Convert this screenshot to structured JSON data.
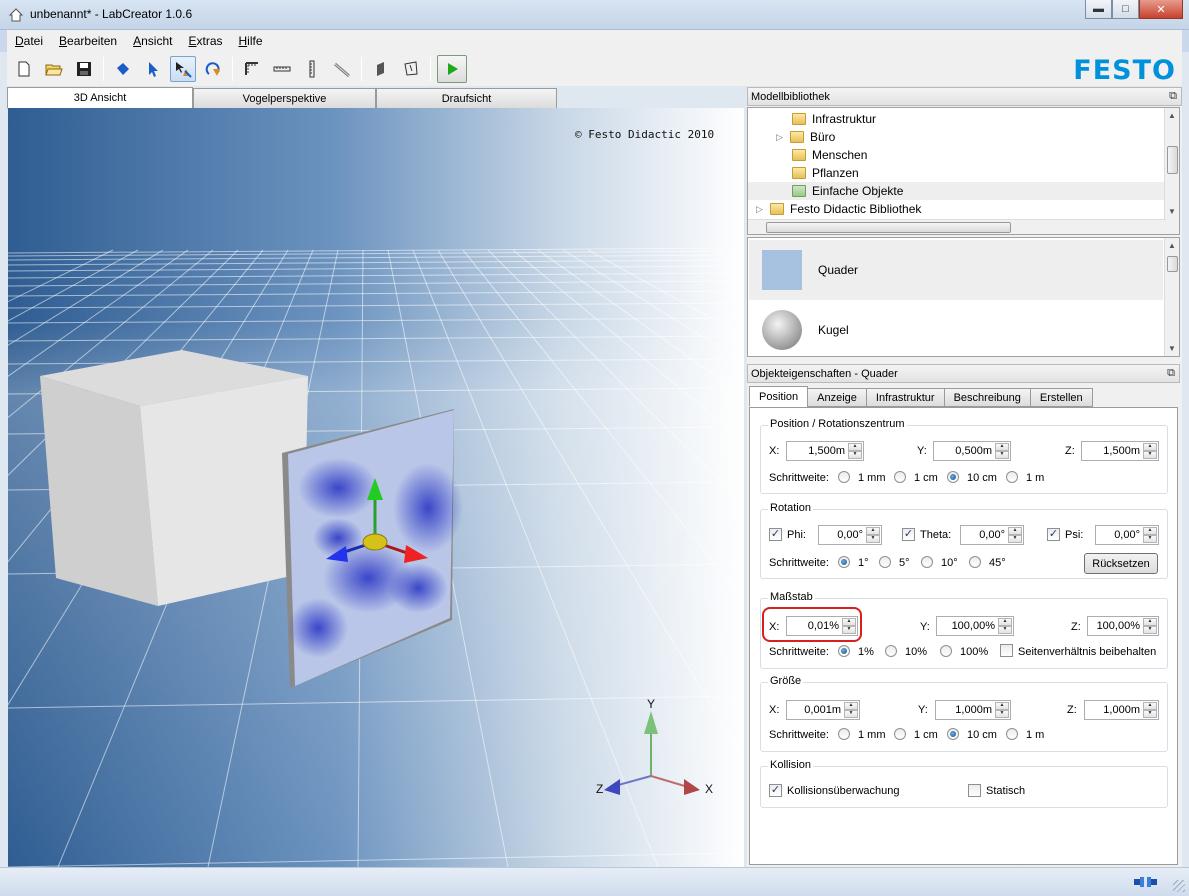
{
  "window": {
    "title": "unbenannt* - LabCreator 1.0.6",
    "minimize": "▬",
    "maximize": "□",
    "close": "✕"
  },
  "menu": [
    {
      "label": "Datei",
      "accel": "D",
      "rest": "atei"
    },
    {
      "label": "Bearbeiten",
      "accel": "B",
      "rest": "earbeiten"
    },
    {
      "label": "Ansicht",
      "accel": "A",
      "rest": "nsicht"
    },
    {
      "label": "Extras",
      "accel": "E",
      "rest": "xtras"
    },
    {
      "label": "Hilfe",
      "accel": "H",
      "rest": "ilfe"
    }
  ],
  "toolbar": {
    "buttons": [
      "new-file-icon",
      "open-folder-icon",
      "save-icon",
      "select-blue-icon",
      "pointer-icon",
      "move-tool-icon",
      "rotate-tool-icon",
      "measure-corner-icon",
      "ruler-horizontal-icon",
      "ruler-vertical-icon",
      "measure-diagonal-icon",
      "wall-icon",
      "polygon-icon",
      "play-icon"
    ],
    "brand": "FESTO",
    "brand_color": "#0091dc"
  },
  "view_tabs": [
    "3D Ansicht",
    "Vogelperspektive",
    "Draufsicht"
  ],
  "viewport": {
    "copyright": "© Festo Didactic 2010",
    "axes": {
      "y": "Y",
      "x": "X",
      "z": "Z"
    }
  },
  "library": {
    "title": "Modellbibliothek",
    "tree": [
      {
        "label": "Infrastruktur",
        "expander": "",
        "kind": "folder"
      },
      {
        "label": "Büro",
        "expander": "▷",
        "kind": "folder"
      },
      {
        "label": "Menschen",
        "expander": "",
        "kind": "folder"
      },
      {
        "label": "Pflanzen",
        "expander": "",
        "kind": "folder"
      },
      {
        "label": "Einfache Objekte",
        "expander": "",
        "kind": "folder-green"
      },
      {
        "label": "Festo Didactic Bibliothek",
        "expander": "▷",
        "kind": "folder"
      }
    ],
    "models": [
      {
        "label": "Quader",
        "selected": true
      },
      {
        "label": "Kugel",
        "selected": false
      }
    ]
  },
  "properties": {
    "title": "Objekteigenschaften - Quader",
    "tabs": [
      "Position",
      "Anzeige",
      "Infrastruktur",
      "Beschreibung",
      "Erstellen"
    ],
    "position": {
      "title": "Position / Rotationszentrum",
      "x_label": "X:",
      "x": "1,500m",
      "y_label": "Y:",
      "y": "0,500m",
      "z_label": "Z:",
      "z": "1,500m",
      "step_label": "Schrittweite:",
      "steps": [
        "1 mm",
        "1 cm",
        "10 cm",
        "1 m"
      ],
      "step_selected": "10 cm"
    },
    "rotation": {
      "title": "Rotation",
      "phi_label": "Phi:",
      "phi": "0,00°",
      "theta_label": "Theta:",
      "theta": "0,00°",
      "psi_label": "Psi:",
      "psi": "0,00°",
      "step_label": "Schrittweite:",
      "steps": [
        "1°",
        "5°",
        "10°",
        "45°"
      ],
      "step_selected": "1°",
      "reset": "Rücksetzen"
    },
    "scale": {
      "title": "Maßstab",
      "x_label": "X:",
      "x": "0,01%",
      "y_label": "Y:",
      "y": "100,00%",
      "z_label": "Z:",
      "z": "100,00%",
      "step_label": "Schrittweite:",
      "steps": [
        "1%",
        "10%",
        "100%"
      ],
      "step_selected": "1%",
      "keep_ratio": "Seitenverhältnis beibehalten"
    },
    "size": {
      "title": "Größe",
      "x_label": "X:",
      "x": "0,001m",
      "y_label": "Y:",
      "y": "1,000m",
      "z_label": "Z:",
      "z": "1,000m",
      "step_label": "Schrittweite:",
      "steps": [
        "1 mm",
        "1 cm",
        "10 cm",
        "1 m"
      ],
      "step_selected": "10 cm"
    },
    "collision": {
      "title": "Kollision",
      "monitor": "Kollisionsüberwachung",
      "monitor_checked": true,
      "static": "Statisch",
      "static_checked": false
    }
  }
}
